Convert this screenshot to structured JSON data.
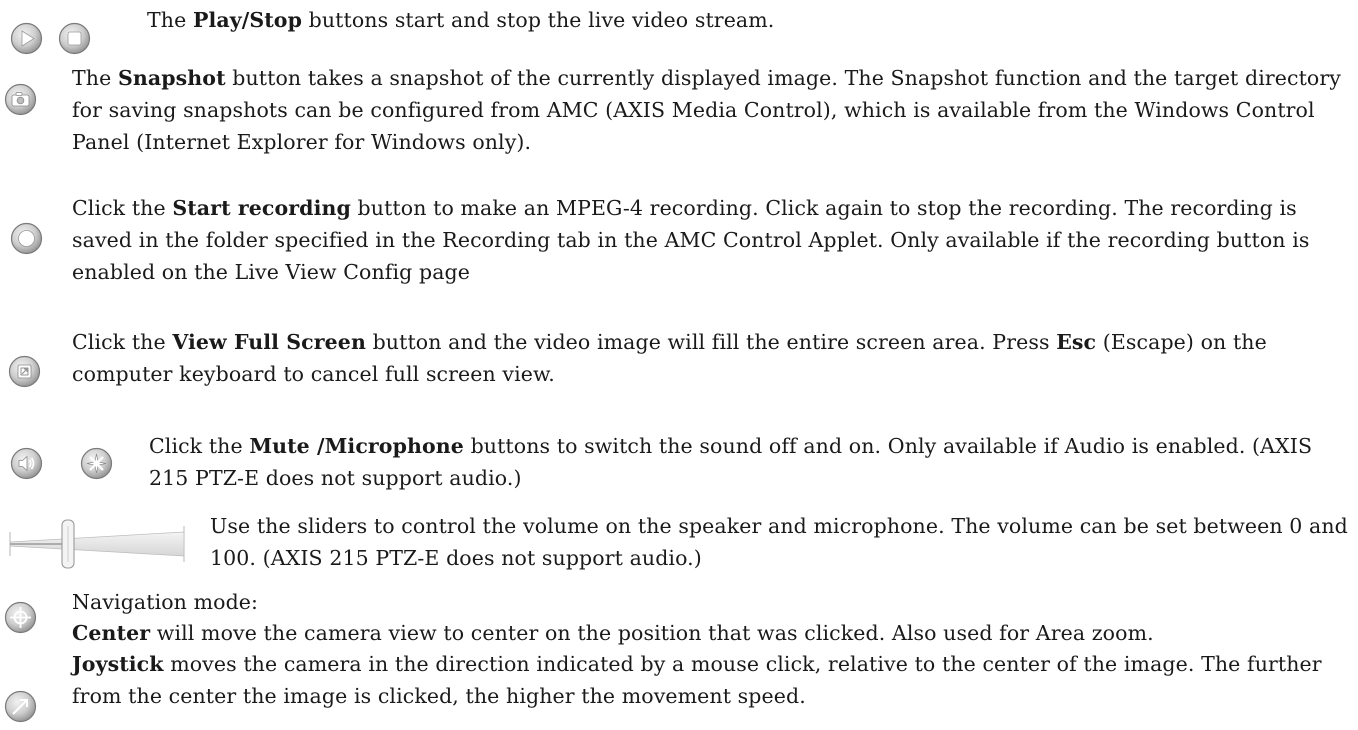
{
  "rows": {
    "play_stop": {
      "icons": [
        "play-icon",
        "stop-icon"
      ],
      "pre": "The ",
      "bold": "Play/Stop",
      "post": " buttons start and stop the live video stream."
    },
    "snapshot": {
      "icons": [
        "camera-icon"
      ],
      "pre": "The ",
      "bold": "Snapshot",
      "post": " button takes a snapshot of the currently displayed image. The Snapshot function and the target directory for saving snapshots can be configured from AMC (AXIS Media Control), which is available from the Windows Control Panel (Internet Explorer for Windows only)."
    },
    "recording": {
      "icons": [
        "record-icon"
      ],
      "pre": "Click the ",
      "bold": "Start recording",
      "post": " button to make an MPEG-4 recording. Click again to stop the recording. The recording is saved in the folder specified in the Recording tab in the AMC Control Applet. Only available if the recording button is enabled on the Live View Config page"
    },
    "fullscreen": {
      "icons": [
        "fullscreen-icon"
      ],
      "pre": "Click the ",
      "bold": "View Full Screen",
      "mid": " button and the video image will fill the entire screen area. Press ",
      "bold2": "Esc",
      "post": " (Escape) on the computer keyboard to cancel full screen view."
    },
    "mute": {
      "icons": [
        "speaker-icon",
        "microphone-icon"
      ],
      "pre": "Click the ",
      "bold": "Mute /Microphone",
      "post": " buttons to switch the sound off and on. Only available if Audio is enabled. (AXIS 215 PTZ-E does not support audio.)"
    },
    "slider": {
      "icons": [
        "volume-slider-icon"
      ],
      "text": "Use the sliders to control the volume on the speaker and microphone. The volume can be set between 0 and 100. (AXIS 215 PTZ-E does not support audio.)"
    },
    "navigation": {
      "icons": [
        "center-icon",
        "joystick-icon"
      ],
      "heading": "Navigation mode:",
      "center_bold": "Center",
      "center_text": " will move the camera view to center on the position that was clicked. Also used for Area zoom.",
      "joystick_bold": "Joystick",
      "joystick_text": " moves the camera in the direction indicated by a mouse click, relative to the center of the image. The further from the center the image is clicked, the higher the movement speed."
    }
  }
}
